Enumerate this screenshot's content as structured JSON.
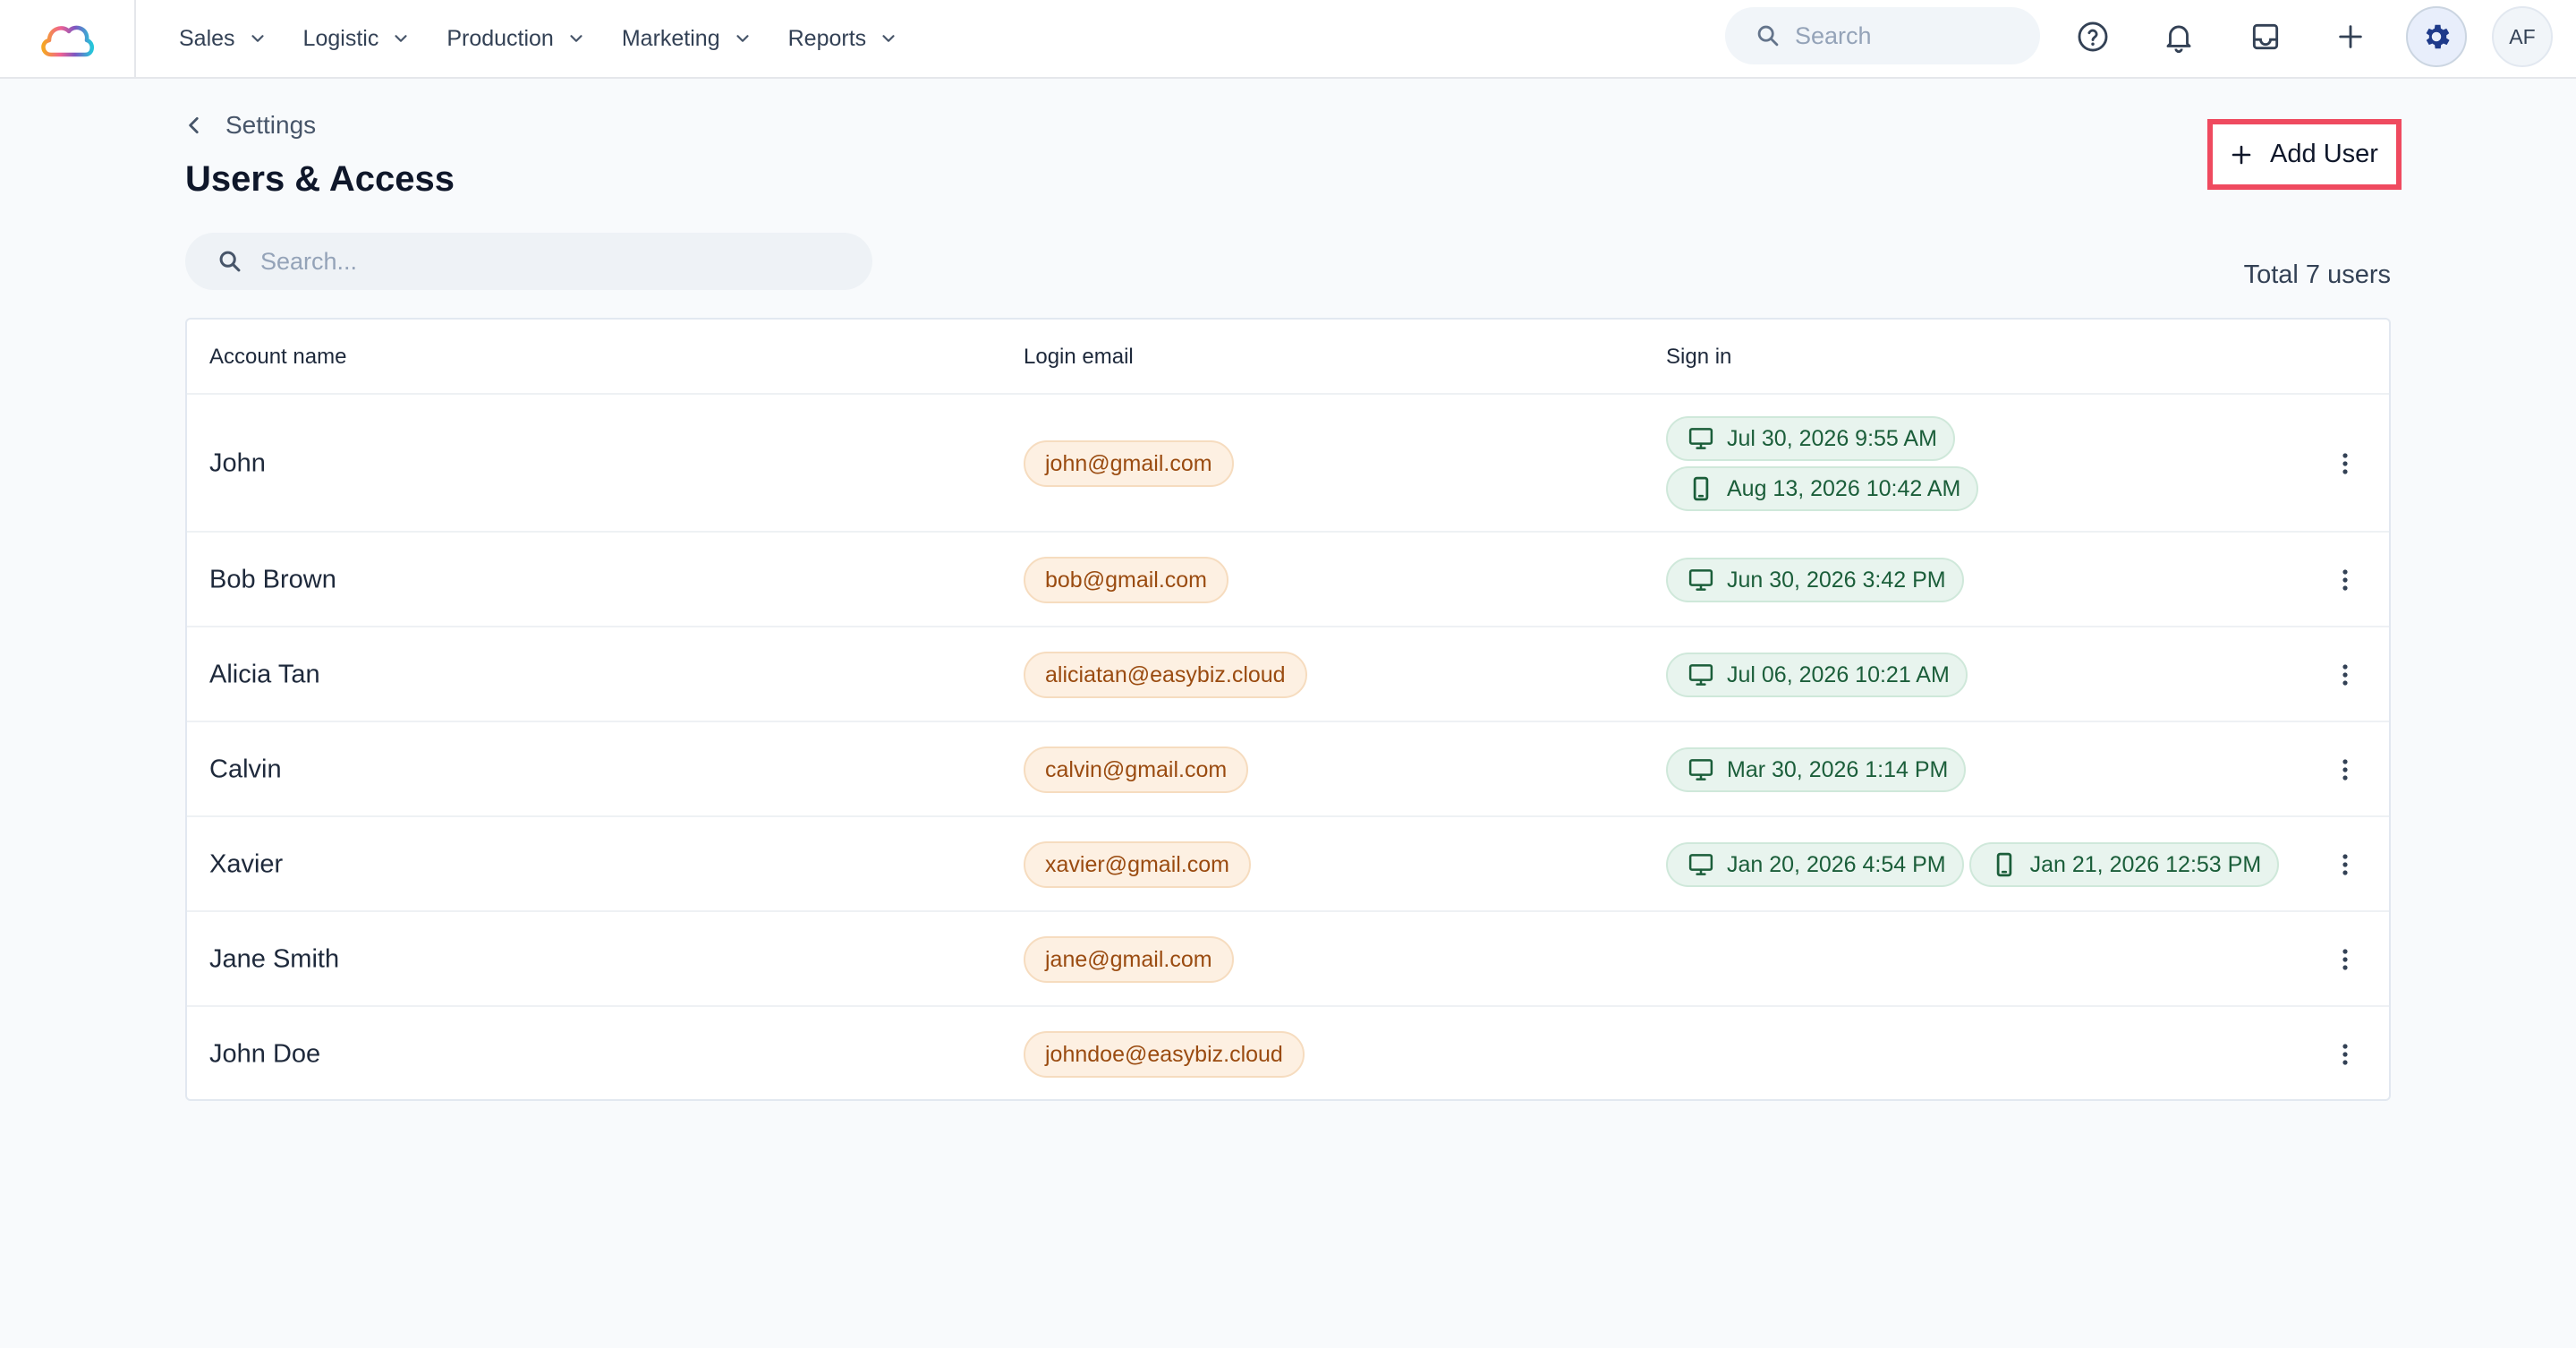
{
  "nav": {
    "items": [
      {
        "label": "Sales"
      },
      {
        "label": "Logistic"
      },
      {
        "label": "Production"
      },
      {
        "label": "Marketing"
      },
      {
        "label": "Reports"
      }
    ],
    "search_placeholder": "Search",
    "avatar_initials": "AF",
    "icons": [
      "help-icon",
      "bell-icon",
      "inbox-icon",
      "plus-icon",
      "gear-icon"
    ]
  },
  "header": {
    "breadcrumb": "Settings",
    "title": "Users & Access",
    "add_user_label": "Add User",
    "search_placeholder": "Search...",
    "total_label": "Total 7 users"
  },
  "table": {
    "columns": [
      "Account name",
      "Login email",
      "Sign in"
    ],
    "rows": [
      {
        "name": "John",
        "email": "john@gmail.com",
        "signins": [
          {
            "device": "desktop",
            "time": "Jul 30, 2026 9:55 AM"
          },
          {
            "device": "mobile",
            "time": "Aug 13, 2026 10:42 AM"
          }
        ]
      },
      {
        "name": "Bob Brown",
        "email": "bob@gmail.com",
        "signins": [
          {
            "device": "desktop",
            "time": "Jun 30, 2026 3:42 PM"
          }
        ]
      },
      {
        "name": "Alicia Tan",
        "email": "aliciatan@easybiz.cloud",
        "signins": [
          {
            "device": "desktop",
            "time": "Jul 06, 2026 10:21 AM"
          }
        ]
      },
      {
        "name": "Calvin",
        "email": "calvin@gmail.com",
        "signins": [
          {
            "device": "desktop",
            "time": "Mar 30, 2026 1:14 PM"
          }
        ]
      },
      {
        "name": "Xavier",
        "email": "xavier@gmail.com",
        "signins": [
          {
            "device": "desktop",
            "time": "Jan 20, 2026 4:54 PM"
          },
          {
            "device": "mobile",
            "time": "Jan 21, 2026 12:53 PM"
          }
        ]
      },
      {
        "name": "Jane Smith",
        "email": "jane@gmail.com",
        "signins": []
      },
      {
        "name": "John Doe",
        "email": "johndoe@easybiz.cloud",
        "signins": []
      }
    ]
  },
  "colors": {
    "highlight_border": "#ef4a5f",
    "email_chip_bg": "#fdf0e2",
    "email_chip_text": "#9a4b10",
    "signin_chip_bg": "#e8f4ee",
    "signin_chip_text": "#1b5e3a",
    "settings_icon": "#1e3a8a"
  }
}
